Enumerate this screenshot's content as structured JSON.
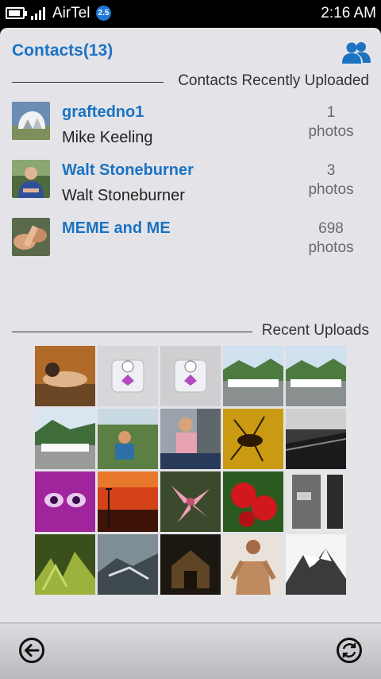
{
  "status": {
    "carrier": "AirTel",
    "network_badge": "2.5",
    "time": "2:16 AM",
    "icons": [
      "battery-icon",
      "signal-icon"
    ]
  },
  "header": {
    "title": "Contacts(13)",
    "icon": "people-icon"
  },
  "sections": {
    "recent_contacts": "Contacts Recently Uploaded",
    "recent_uploads": "Recent Uploads"
  },
  "contacts": [
    {
      "name": "graftedno1",
      "subtitle": "Mike Keeling",
      "count": "1",
      "unit": "photos"
    },
    {
      "name": "Walt Stoneburner",
      "subtitle": "Walt Stoneburner",
      "count": "3",
      "unit": "photos"
    },
    {
      "name": "MEME and ME",
      "subtitle": "",
      "count": "698",
      "unit": "photos"
    }
  ],
  "uploads_count": 20,
  "toolbar": {
    "back_icon": "back-arrow-icon",
    "refresh_icon": "refresh-icon"
  },
  "colors": {
    "accent": "#1b73c2",
    "panel": "#e4e3e8",
    "statusbar": "#000000"
  }
}
